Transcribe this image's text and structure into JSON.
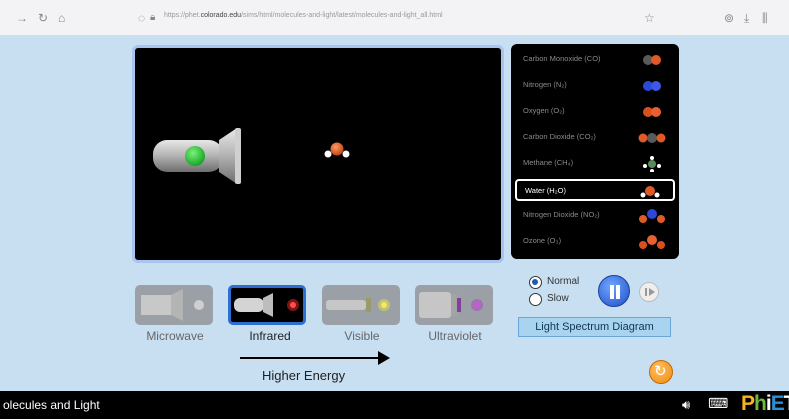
{
  "browser": {
    "back_icon": "arrow-left-icon",
    "reload_icon": "reload-icon",
    "home_icon": "home-icon",
    "url_prefix": "https://phet.",
    "url_domain": "colorado.edu",
    "url_rest": "/sims/html/molecules-and-light/latest/molecules-and-light_all.html",
    "bookmark_icon": "star-icon"
  },
  "molecules": [
    {
      "label": "Carbon Monoxide (CO)",
      "icon": "co-molecule-icon"
    },
    {
      "label": "Nitrogen (N₂)",
      "icon": "n2-molecule-icon"
    },
    {
      "label": "Oxygen (O₂)",
      "icon": "o2-molecule-icon"
    },
    {
      "label": "Carbon Dioxide (CO₂)",
      "icon": "co2-molecule-icon"
    },
    {
      "label": "Methane (CH₄)",
      "icon": "ch4-molecule-icon"
    },
    {
      "label": "Water (H₂O)",
      "icon": "h2o-molecule-icon",
      "selected": true
    },
    {
      "label": "Nitrogen Dioxide (NO₂)",
      "icon": "no2-molecule-icon"
    },
    {
      "label": "Ozone (O₃)",
      "icon": "o3-molecule-icon"
    }
  ],
  "light_sources": [
    {
      "label": "Microwave",
      "color": "#bbbbbb"
    },
    {
      "label": "Infrared",
      "color": "#ff2a2a",
      "selected": true
    },
    {
      "label": "Visible",
      "color": "#e8e040"
    },
    {
      "label": "Ultraviolet",
      "color": "#b040c0"
    }
  ],
  "energy_label": "Higher Energy",
  "speed": {
    "normal": "Normal",
    "slow": "Slow",
    "selected": "normal"
  },
  "spectrum_button": "Light Spectrum Diagram",
  "sim_title": "olecules and Light",
  "colors": {
    "background": "#c8dff2",
    "stage_border": "#a7c5ef",
    "selected_source_border": "#2c6fd0",
    "emitter_button": "#22c03a",
    "oxygen": "#e0602a",
    "hydrogen": "#ffffff",
    "nitrogen": "#3050e0",
    "carbon": "#606060"
  }
}
